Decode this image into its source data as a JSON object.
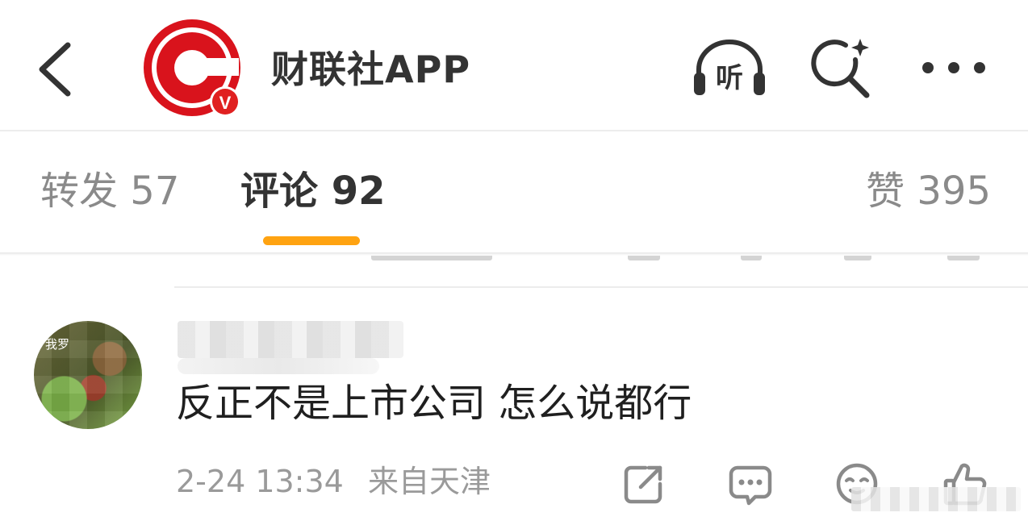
{
  "header": {
    "title": "财联社APP",
    "icons": {
      "back": "back-arrow-icon",
      "listen": "listen-headphones-icon",
      "listen_glyph": "听",
      "search": "ai-search-icon",
      "more": "more-dots-icon"
    },
    "logo_badge": "V",
    "brand_color": "#d9131c"
  },
  "tabs": {
    "repost_label": "转发",
    "repost_count": "57",
    "comments_label": "评论",
    "comments_count": "92",
    "likes_label": "赞",
    "likes_count": "395",
    "active": "comments",
    "accent_color": "#ffa311"
  },
  "comment": {
    "avatar_tag": "我罗",
    "text": "反正不是上市公司 怎么说都行",
    "time": "2-24 13:34",
    "location": "来自天津",
    "actions": [
      "share-icon",
      "reply-icon",
      "emoji-react-icon",
      "like-icon"
    ]
  }
}
